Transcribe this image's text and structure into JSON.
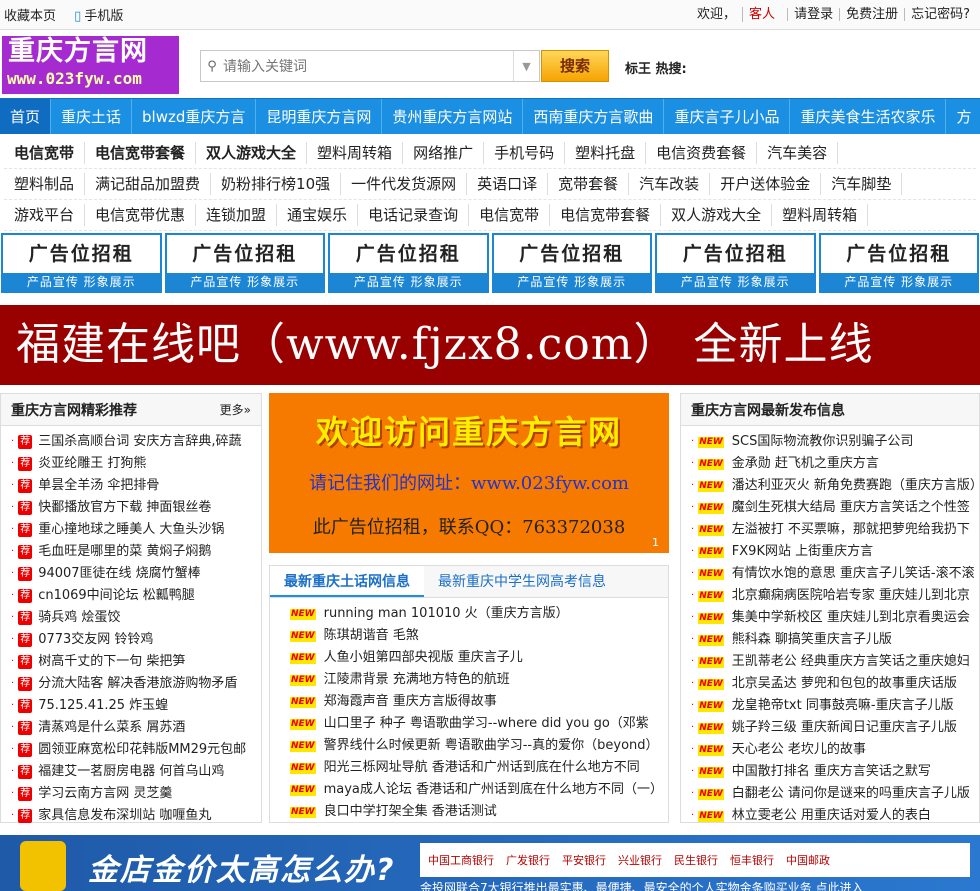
{
  "topbar": {
    "fav": "收藏本页",
    "mobile": "手机版",
    "welcome": "欢迎，",
    "guest": "客人",
    "login": "请登录",
    "register": "免费注册",
    "forgot": "忘记密码?"
  },
  "logo": {
    "line1": "重庆方言网",
    "line2": "www.023fyw.com"
  },
  "search": {
    "placeholder": "请输入关键词",
    "button": "搜索",
    "hot_label": "标王  热搜:"
  },
  "nav": [
    "首页",
    "重庆土话",
    "blwzd重庆方言",
    "昆明重庆方言网",
    "贵州重庆方言网站",
    "西南重庆方言歌曲",
    "重庆言子儿小品",
    "重庆美食生活农家乐",
    "方"
  ],
  "links": [
    [
      "电信宽带",
      "电信宽带套餐",
      "双人游戏大全",
      "塑料周转箱",
      "网络推广",
      "手机号码",
      "塑料托盘",
      "电信资费套餐",
      "汽车美容"
    ],
    [
      "塑料制品",
      "满记甜品加盟费",
      "奶粉排行榜10强",
      "一件代发货源网",
      "英语口译",
      "宽带套餐",
      "汽车改装",
      "开户送体验金",
      "汽车脚垫"
    ],
    [
      "游戏平台",
      "电信宽带优惠",
      "连锁加盟",
      "通宝娱乐",
      "电话记录查询",
      "电信宽带",
      "电信宽带套餐",
      "双人游戏大全",
      "塑料周转箱"
    ]
  ],
  "ads": {
    "title": "广告位招租",
    "sub": "产品宣传 形象展示"
  },
  "banner": "福建在线吧（www.fjzx8.com） 全新上线",
  "left": {
    "title": "重庆方言网精彩推荐",
    "more": "更多»",
    "badge": "荐",
    "items": [
      "三国杀高顺台词 安庆方言辞典,碎蔬",
      "炎亚纶雕王 打狗熊",
      "单昙全羊汤 伞把排骨",
      "快鄱播放官方下载 抻面银丝卷",
      "重心撞地球之睡美人 大鱼头沙锅",
      "毛血旺是哪里的菜 黄焖子焖鹅",
      "94007匪徒在线 烧腐竹蟹棒",
      "cn1069中间论坛 松瓤鸭腿",
      "骑兵鸡 烩蛋饺",
      "0773交友网 铃铃鸡",
      "树高千丈的下一句 柴把笋",
      "分流大陆客 解决香港旅游购物矛盾",
      "75.125.41.25 炸玉蝗",
      "清蒸鸡是什么菜系 屑苏酒",
      "圆领亚麻宽松印花韩版MM29元包邮",
      "福建艾一茗厨房电器 何首乌山鸡",
      "学习云南方言网 灵芝羹",
      "家具信息发布深圳站 咖喱鱼丸"
    ]
  },
  "center": {
    "welcome": "欢迎访问重庆方言网",
    "remember": "请记住我们的网址：www.023fyw.com",
    "ad": "此广告位招租，联系QQ：763372038",
    "page": "1",
    "tab1": "最新重庆土话网信息",
    "tab2": "最新重庆中学生网高考信息",
    "new": "NEW",
    "items": [
      "running man 101010 火（重庆方言版）",
      "陈琪胡谐音 毛煞",
      "人鱼小姐第四部央视版 重庆言子儿",
      "江陵肃背景 充满地方特色的航班",
      "郑海霞声音 重庆方言版得故事",
      "山口里子 种子 粤语歌曲学习--where did you go（邓紫",
      "警界线什么时候更新 粤语歌曲学习--真的爱你（beyond）",
      "阳光三栎网址导航 香港话和广州话到底在什么地方不同",
      "maya成人论坛 香港话和广州话到底在什么地方不同（一）",
      "良口中学打架全集 香港话测试"
    ]
  },
  "right": {
    "title": "重庆方言网最新发布信息",
    "new": "NEW",
    "items": [
      "SCS国际物流教你识别骗子公司",
      "金承勋 赶飞机之重庆方言",
      "潘达利亚灭火 新角免费赛跑（重庆方言版）",
      "魔剑生死棋大结局 重庆方言笑话之个性签",
      "左溢被打 不买票嘛，那就把萝兜给我扔下",
      "FX9K网站 上街重庆方言",
      "有情饮水饱的意思 重庆言子儿笑话-滚不滚",
      "北京癫痫病医院哈岩专家 重庆娃儿到北京",
      "集美中学新校区 重庆娃儿到北京看奥运会",
      "熊科森 聊搞笑重庆言子儿版",
      "王凯蒂老公 经典重庆方言笑话之重庆媳妇",
      "北京吴孟达 萝兜和包包的故事重庆话版",
      "龙皇艳帝txt 同事鼓亮嘛-重庆言子儿版",
      "姚子羚三级 重庆新闻日记重庆言子儿版",
      "天心老公 老坎儿的故事",
      "中国散打排名 重庆方言笑话之默写",
      "白翻老公 请问你是谜来的吗重庆言子儿版",
      "林立雯老公 用重庆话对爱人的表白"
    ]
  },
  "bottom": {
    "title": "金店金价太高怎么办?",
    "banks": [
      "中国工商银行",
      "广发银行",
      "平安银行",
      "兴业银行",
      "民生银行",
      "恒丰银行",
      "中国邮政"
    ],
    "sub": "金投网联合7大银行推出最实惠、最便捷、最安全的个人实物金条购买业务 点此进入"
  },
  "colors": {
    "nav": "#1b8fe1",
    "banner": "#990000",
    "logo": "#a52bd1",
    "orange": "#f77a00"
  }
}
